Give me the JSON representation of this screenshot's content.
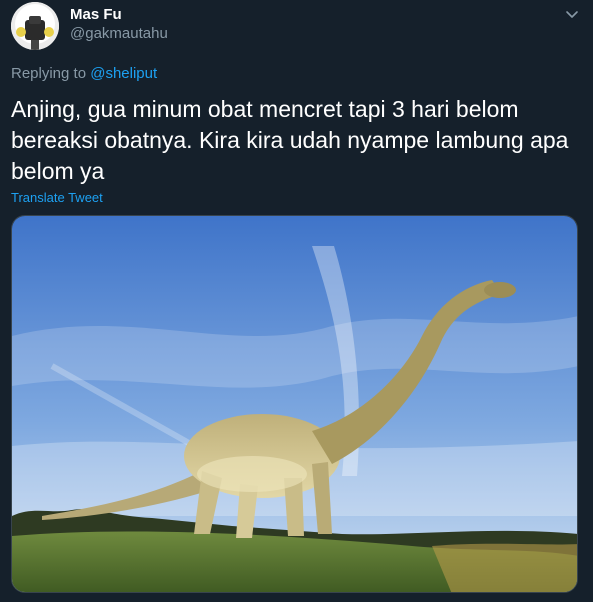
{
  "user": {
    "display_name": "Mas Fu",
    "handle": "@gakmautahu",
    "avatar_icon": "profile-photo"
  },
  "reply": {
    "prefix": "Replying to",
    "mention": "@sheliput"
  },
  "tweet": {
    "text": "Anjing, gua minum obat mencret tapi 3 hari belom bereaksi obatnya. Kira kira udah nyampe lambung apa belom ya",
    "translate_label": "Translate Tweet"
  },
  "media": {
    "alt": "dinosaur-statue-photo"
  },
  "colors": {
    "background": "#15202b",
    "text_primary": "#ffffff",
    "text_secondary": "#8899a6",
    "accent": "#1da1f2"
  },
  "icons": {
    "more": "chevron-down-icon"
  }
}
